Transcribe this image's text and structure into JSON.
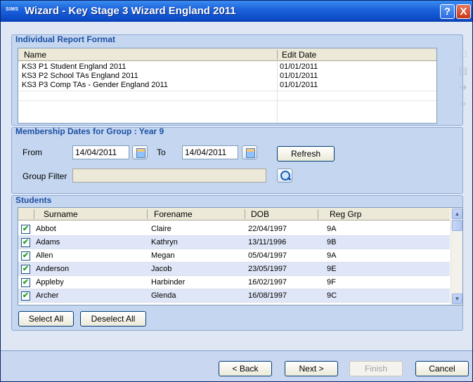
{
  "window": {
    "logo": "SIMS",
    "title": "Wizard - Key Stage 3 Wizard England 2011",
    "help_label": "?",
    "close_label": "X"
  },
  "report_format": {
    "title": "Individual Report Format",
    "columns": [
      "Name",
      "Edit Date"
    ],
    "rows": [
      {
        "name": "KS3 P1 Student England 2011",
        "edit_date": "01/01/2011"
      },
      {
        "name": "KS3 P2 School TAs England 2011",
        "edit_date": "01/01/2011"
      },
      {
        "name": "KS3 P3 Comp TAs - Gender England 2011",
        "edit_date": "01/01/2011"
      }
    ],
    "side_icons": [
      "preview-icon",
      "print-icon",
      "export-icon",
      "link-icon"
    ]
  },
  "membership": {
    "title": "Membership Dates for Group : Year 9",
    "from_label": "From",
    "from_value": "14/04/2011",
    "to_label": "To",
    "to_value": "14/04/2011",
    "refresh_label": "Refresh",
    "group_filter_label": "Group Filter",
    "group_filter_value": ""
  },
  "students": {
    "title": "Students",
    "columns": [
      "Surname",
      "Forename",
      "DOB",
      "Reg Grp"
    ],
    "rows": [
      {
        "checked": true,
        "surname": "Abbot",
        "forename": "Claire",
        "dob": "22/04/1997",
        "reg": "9A"
      },
      {
        "checked": true,
        "surname": "Adams",
        "forename": "Kathryn",
        "dob": "13/11/1996",
        "reg": "9B"
      },
      {
        "checked": true,
        "surname": "Allen",
        "forename": "Megan",
        "dob": "05/04/1997",
        "reg": "9A"
      },
      {
        "checked": true,
        "surname": "Anderson",
        "forename": "Jacob",
        "dob": "23/05/1997",
        "reg": "9E"
      },
      {
        "checked": true,
        "surname": "Appleby",
        "forename": "Harbinder",
        "dob": "16/02/1997",
        "reg": "9F"
      },
      {
        "checked": true,
        "surname": "Archer",
        "forename": "Glenda",
        "dob": "16/08/1997",
        "reg": "9C"
      }
    ],
    "select_all_label": "Select All",
    "deselect_all_label": "Deselect All"
  },
  "footer": {
    "back_label": "< Back",
    "next_label": "Next >",
    "finish_label": "Finish",
    "cancel_label": "Cancel"
  },
  "colors": {
    "titlebar": "#0c4cc8",
    "panel": "#c5d6f0",
    "panel_title": "#1c51a3",
    "check": "#21a121"
  }
}
